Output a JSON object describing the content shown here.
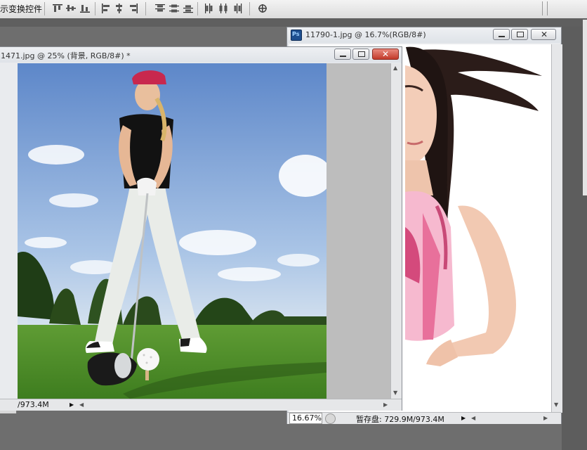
{
  "toolbar": {
    "label": "示变换控件"
  },
  "left_window": {
    "title": "1471.jpg @ 25% (背景, RGB/8#) *",
    "status": "/973.4M"
  },
  "right_window": {
    "title": "11790-1.jpg @ 16.7%(RGB/8#)",
    "zoom": "16.67%",
    "status": "暂存盘: 729.9M/973.4M",
    "app_icon": "Ps"
  },
  "colors": {
    "accent": "#2b86d8",
    "close": "#c23a2a",
    "workspace": "#6e6e6e"
  },
  "icons": [
    "align-top-icon",
    "align-vcenter-icon",
    "align-bottom-icon",
    "align-left-icon",
    "align-hcenter-icon",
    "align-right-icon",
    "distribute-top-icon",
    "distribute-vcenter-icon",
    "distribute-bottom-icon",
    "distribute-left-icon",
    "distribute-hcenter-icon",
    "distribute-right-icon",
    "auto-align-icon"
  ]
}
